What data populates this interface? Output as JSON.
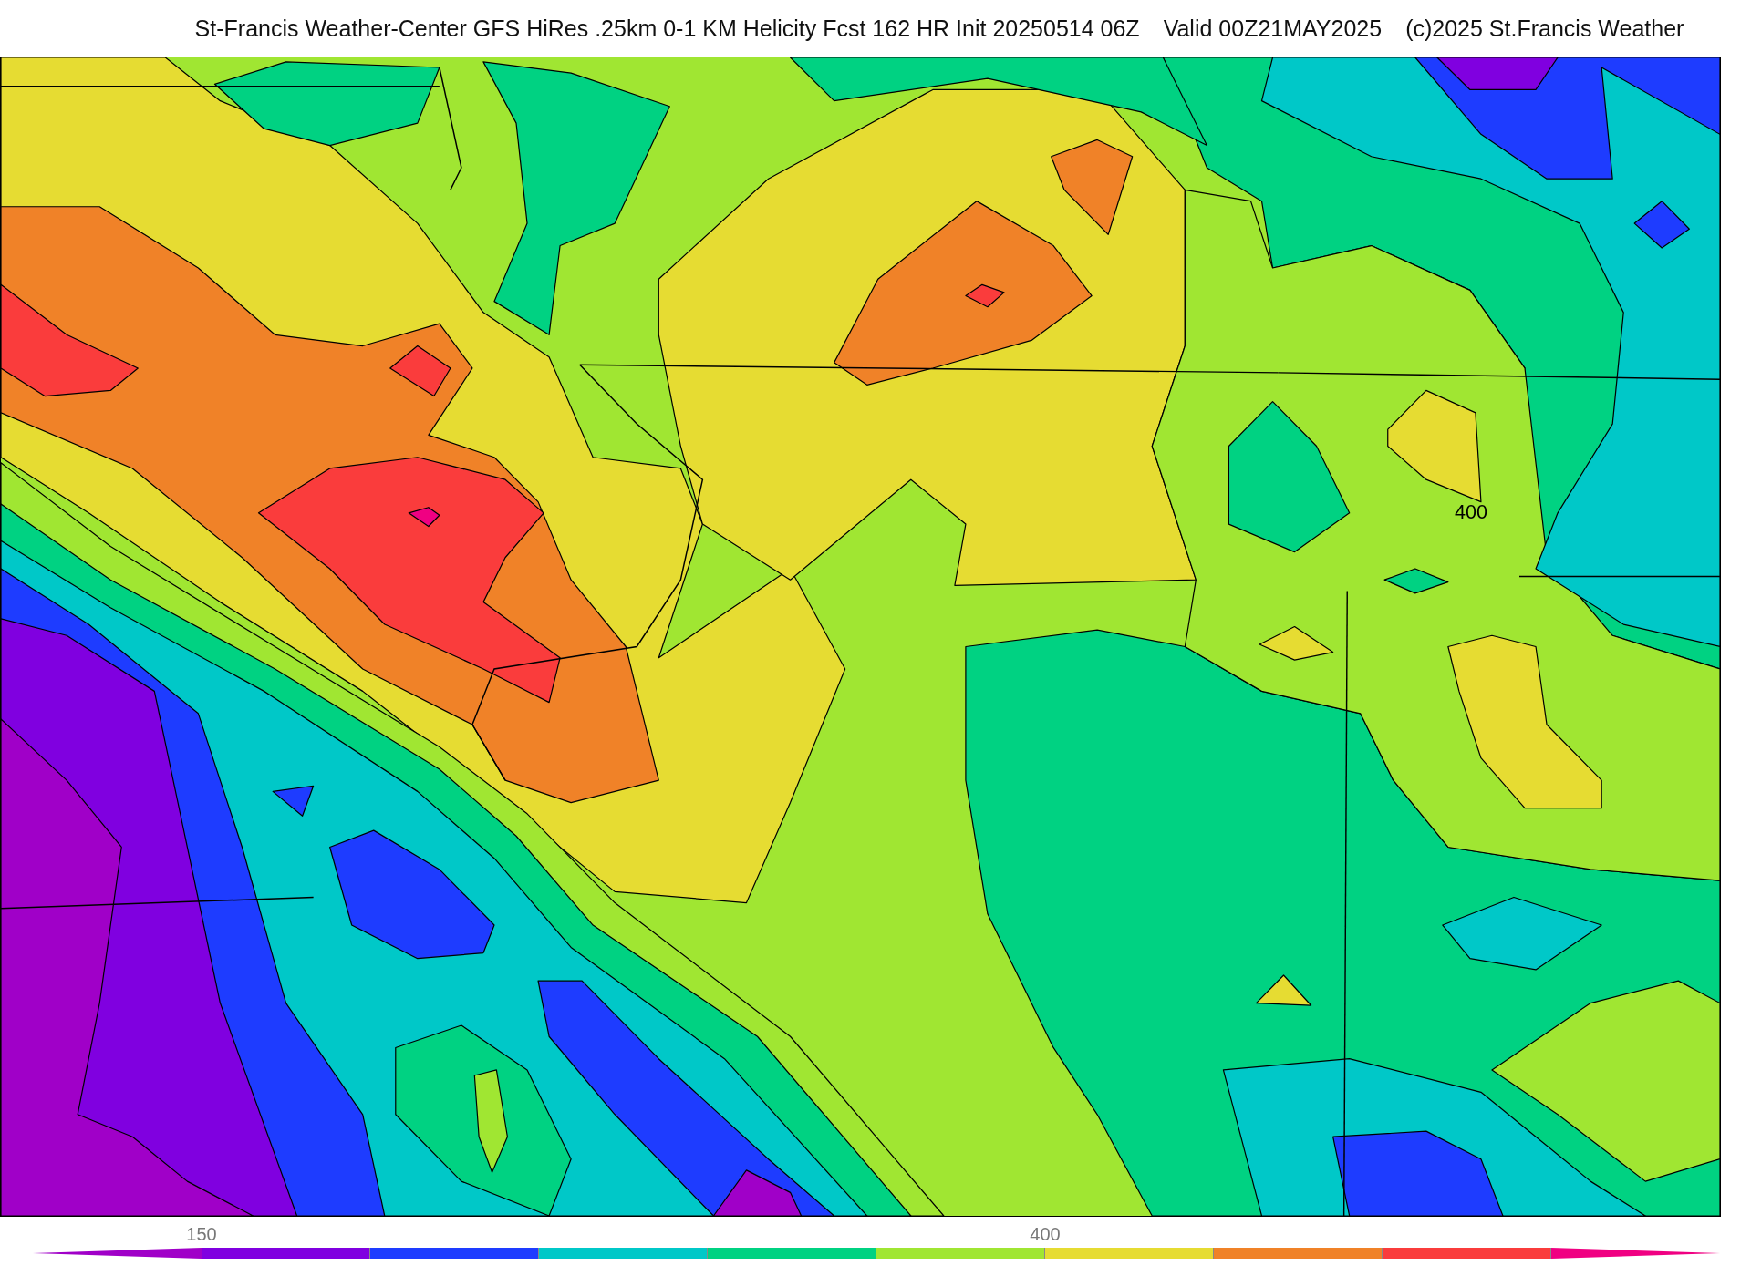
{
  "header": {
    "title": "St-Francis Weather-Center GFS HiRes .25km 0-1 KM Helicity Fcst 162 HR Init 20250514 06Z",
    "valid": "Valid 00Z21MAY2025",
    "copyright": "(c)2025 St.Francis Weather"
  },
  "map": {
    "contour_labels": [
      "400"
    ]
  },
  "colorbar": {
    "bins": [
      {
        "kind": "arrow",
        "color": "#a000c8"
      },
      {
        "kind": "bin",
        "color": "#8000e0",
        "tick": "150"
      },
      {
        "kind": "bin",
        "color": "#1e3cff"
      },
      {
        "kind": "bin",
        "color": "#00c8c8"
      },
      {
        "kind": "bin",
        "color": "#00d282"
      },
      {
        "kind": "bin",
        "color": "#a0e632"
      },
      {
        "kind": "bin",
        "color": "#e6dc32",
        "tick": "400"
      },
      {
        "kind": "bin",
        "color": "#f08228"
      },
      {
        "kind": "bin",
        "color": "#fa3c3c"
      },
      {
        "kind": "arrow",
        "color": "#f00082"
      }
    ]
  }
}
